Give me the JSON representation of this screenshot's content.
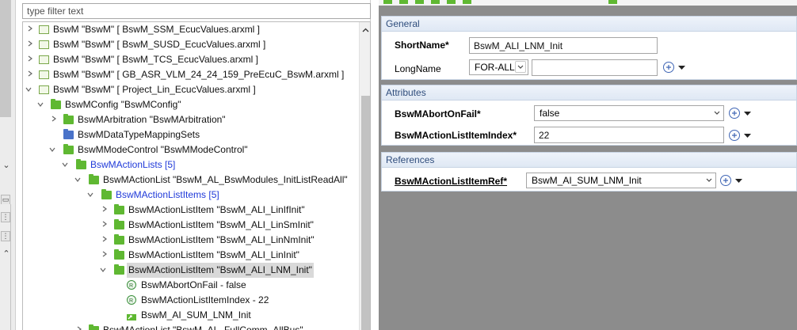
{
  "filter": {
    "placeholder": "type filter text"
  },
  "tree": {
    "rows": [
      "BswM \"BswM\" [ BswM_SSM_EcucValues.arxml ]",
      "BswM \"BswM\" [ BswM_SUSD_EcucValues.arxml ]",
      "BswM \"BswM\" [ BswM_TCS_EcucValues.arxml ]",
      "BswM \"BswM\" [ GB_ASR_VLM_24_24_159_PreEcuC_BswM.arxml ]",
      "BswM \"BswM\" [ Project_Lin_EcucValues.arxml ]",
      "BswMConfig \"BswMConfig\"",
      "BswMArbitration \"BswMArbitration\"",
      "BswMDataTypeMappingSets",
      "BswMModeControl \"BswMModeControl\"",
      "BswMActionLists [5]",
      "BswMActionList \"BswM_AL_BswModules_InitListReadAll\"",
      "BswMActionListItems [5]",
      "BswMActionListItem \"BswM_ALI_LinIfInit\"",
      "BswMActionListItem \"BswM_ALI_LinSmInit\"",
      "BswMActionListItem \"BswM_ALI_LinNmInit\"",
      "BswMActionListItem \"BswM_ALI_LinInit\"",
      "BswMActionListItem \"BswM_ALI_LNM_Init\"",
      "BswMAbortOnFail - false",
      "BswMActionListItemIndex - 22",
      "BswM_AI_SUM_LNM_Init",
      "BswMActionList \"BswM_AL_FullComm_AllBus\""
    ]
  },
  "editor": {
    "general": {
      "title": "General",
      "short_name_label": "ShortName*",
      "short_name_value": "BswM_ALI_LNM_Init",
      "long_name_label": "LongName",
      "lang_value": "FOR-ALL",
      "long_name_value": ""
    },
    "attributes": {
      "title": "Attributes",
      "abort_label": "BswMAbortOnFail*",
      "abort_value": "false",
      "index_label": "BswMActionListItemIndex*",
      "index_value": "22"
    },
    "references": {
      "title": "References",
      "ref_label": "BswMActionListItemRef*",
      "ref_value": "BswM_AI_SUM_LNM_Init"
    }
  },
  "colors": {
    "link": "#1f39d9",
    "folder_green": "#5fb832",
    "folder_blue": "#4a73c9",
    "section_header": "#2f4d7c",
    "editor_bg": "#8c8c8c"
  }
}
